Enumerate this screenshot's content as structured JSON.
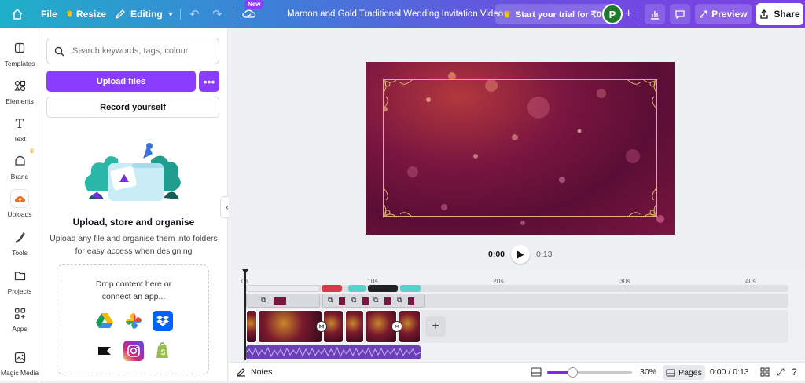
{
  "topbar": {
    "file_label": "File",
    "resize_label": "Resize",
    "editing_label": "Editing",
    "new_badge": "New",
    "doc_title": "Maroon and Gold Traditional Wedding Invitation Video",
    "trial_label": "Start your trial for ₹0",
    "avatar_letter": "P",
    "preview_label": "Preview",
    "share_label": "Share"
  },
  "rail": {
    "items": [
      {
        "label": "Templates",
        "icon": "templates-icon"
      },
      {
        "label": "Elements",
        "icon": "elements-icon"
      },
      {
        "label": "Text",
        "icon": "text-icon"
      },
      {
        "label": "Brand",
        "icon": "brand-icon"
      },
      {
        "label": "Uploads",
        "icon": "uploads-icon"
      },
      {
        "label": "Tools",
        "icon": "tools-icon"
      },
      {
        "label": "Projects",
        "icon": "projects-icon"
      },
      {
        "label": "Apps",
        "icon": "apps-icon"
      },
      {
        "label": "Magic Media",
        "icon": "magic-media-icon"
      }
    ]
  },
  "panel": {
    "search_placeholder": "Search keywords, tags, colour",
    "upload_label": "Upload files",
    "record_label": "Record yourself",
    "title": "Upload, store and organise",
    "description": "Upload any file and organise them into folders for easy access when designing",
    "drop_line1": "Drop content here or",
    "drop_line2": "connect an app...",
    "apps": [
      "google-drive-icon",
      "google-photos-icon",
      "dropbox-icon",
      "box-icon",
      "instagram-icon",
      "shopify-icon"
    ]
  },
  "player": {
    "current": "0:00",
    "total": "0:13"
  },
  "timeline": {
    "ticks": [
      "0s",
      "10s",
      "20s",
      "30s",
      "40s"
    ]
  },
  "bottombar": {
    "notes_label": "Notes",
    "zoom": "30%",
    "zoom_fraction": 0.3,
    "pages_label": "Pages",
    "time": "0:00 / 0:13"
  },
  "colors": {
    "accent": "#8b3dff",
    "canvas_maroon": "#6a1238",
    "gold": "#d9b56a"
  }
}
